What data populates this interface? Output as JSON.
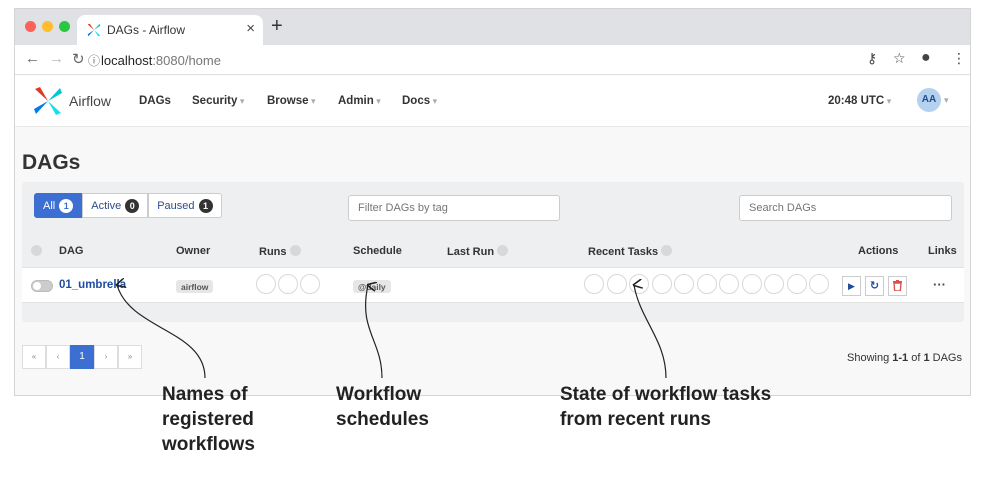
{
  "browser": {
    "tab_title": "DAGs - Airflow",
    "url_host": "localhost",
    "url_path": ":8080/home"
  },
  "navbar": {
    "brand": "Airflow",
    "menu": [
      "DAGs",
      "Security",
      "Browse",
      "Admin",
      "Docs"
    ],
    "time": "20:48 UTC",
    "user_initials": "AA"
  },
  "page": {
    "title": "DAGs",
    "filters": [
      {
        "label": "All",
        "count": "1"
      },
      {
        "label": "Active",
        "count": "0"
      },
      {
        "label": "Paused",
        "count": "1"
      }
    ],
    "tag_filter_placeholder": "Filter DAGs by tag",
    "search_placeholder": "Search DAGs",
    "columns": {
      "dag": "DAG",
      "owner": "Owner",
      "runs": "Runs",
      "schedule": "Schedule",
      "last_run": "Last Run",
      "recent_tasks": "Recent Tasks",
      "actions": "Actions",
      "links": "Links"
    },
    "rows": [
      {
        "dag_id": "01_umbrella",
        "owner": "airflow",
        "schedule": "@daily",
        "paused": true
      }
    ],
    "recent_task_slots": 11,
    "run_slots": 3,
    "pagination": {
      "first": "«",
      "prev": "‹",
      "current": "1",
      "next": "›",
      "last": "»"
    },
    "showing": {
      "prefix": "Showing ",
      "range": "1-1",
      "of": " of ",
      "total": "1",
      "suffix": " DAGs"
    }
  },
  "annotations": {
    "names": [
      "Names of",
      "registered",
      "workflows"
    ],
    "schedules": [
      "Workflow",
      "schedules"
    ],
    "states": [
      "State of workflow tasks",
      "from recent runs"
    ]
  },
  "colors": {
    "accent": "#3c6fd1",
    "link": "#1e4d9e",
    "trigger": "#1e4d9e",
    "refresh": "#1e4d9e",
    "delete": "#d9534f"
  }
}
